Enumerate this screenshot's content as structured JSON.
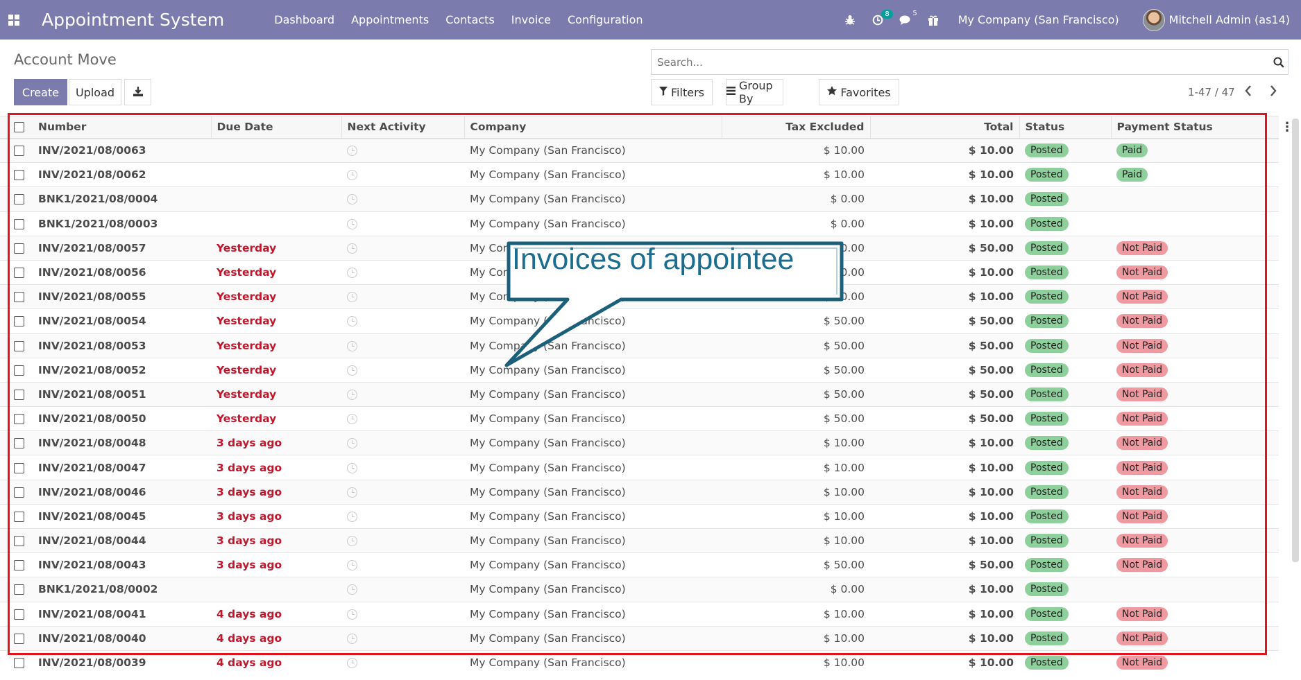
{
  "navbar": {
    "app_title": "Appointment System",
    "menu": [
      "Dashboard",
      "Appointments",
      "Contacts",
      "Invoice",
      "Configuration"
    ],
    "activity_count": "8",
    "messages_count": "5",
    "company": "My Company (San Francisco)",
    "user": "Mitchell Admin (as14)",
    "icons": [
      "apps-grid-icon",
      "bug-icon",
      "activity-clock-icon",
      "chat-icon",
      "gift-icon"
    ]
  },
  "control_panel": {
    "title": "Account Move",
    "search_placeholder": "Search...",
    "create_label": "Create",
    "upload_label": "Upload",
    "filters_label": "Filters",
    "groupby_label": "Group By",
    "favorites_label": "Favorites",
    "pager": "1-47 / 47"
  },
  "table": {
    "columns": [
      "Number",
      "Due Date",
      "Next Activity",
      "Company",
      "Tax Excluded",
      "Total",
      "Status",
      "Payment Status"
    ],
    "rows": [
      {
        "number": "INV/2021/08/0063",
        "due": "",
        "company": "My Company (San Francisco)",
        "tax_excluded": "$ 10.00",
        "total": "$ 10.00",
        "status": "Posted",
        "payment": "Paid"
      },
      {
        "number": "INV/2021/08/0062",
        "due": "",
        "company": "My Company (San Francisco)",
        "tax_excluded": "$ 10.00",
        "total": "$ 10.00",
        "status": "Posted",
        "payment": "Paid"
      },
      {
        "number": "BNK1/2021/08/0004",
        "due": "",
        "company": "My Company (San Francisco)",
        "tax_excluded": "$ 0.00",
        "total": "$ 10.00",
        "status": "Posted",
        "payment": ""
      },
      {
        "number": "BNK1/2021/08/0003",
        "due": "",
        "company": "My Company (San Francisco)",
        "tax_excluded": "$ 0.00",
        "total": "$ 10.00",
        "status": "Posted",
        "payment": ""
      },
      {
        "number": "INV/2021/08/0057",
        "due": "Yesterday",
        "company": "My Company (San Francisco)",
        "tax_excluded": "$ 50.00",
        "total": "$ 50.00",
        "status": "Posted",
        "payment": "Not Paid"
      },
      {
        "number": "INV/2021/08/0056",
        "due": "Yesterday",
        "company": "My Company (San Francisco)",
        "tax_excluded": "$ 10.00",
        "total": "$ 10.00",
        "status": "Posted",
        "payment": "Not Paid"
      },
      {
        "number": "INV/2021/08/0055",
        "due": "Yesterday",
        "company": "My Company (San Francisco)",
        "tax_excluded": "$ 10.00",
        "total": "$ 10.00",
        "status": "Posted",
        "payment": "Not Paid"
      },
      {
        "number": "INV/2021/08/0054",
        "due": "Yesterday",
        "company": "My Company (San Francisco)",
        "tax_excluded": "$ 50.00",
        "total": "$ 50.00",
        "status": "Posted",
        "payment": "Not Paid"
      },
      {
        "number": "INV/2021/08/0053",
        "due": "Yesterday",
        "company": "My Company (San Francisco)",
        "tax_excluded": "$ 50.00",
        "total": "$ 50.00",
        "status": "Posted",
        "payment": "Not Paid"
      },
      {
        "number": "INV/2021/08/0052",
        "due": "Yesterday",
        "company": "My Company (San Francisco)",
        "tax_excluded": "$ 50.00",
        "total": "$ 50.00",
        "status": "Posted",
        "payment": "Not Paid"
      },
      {
        "number": "INV/2021/08/0051",
        "due": "Yesterday",
        "company": "My Company (San Francisco)",
        "tax_excluded": "$ 50.00",
        "total": "$ 50.00",
        "status": "Posted",
        "payment": "Not Paid"
      },
      {
        "number": "INV/2021/08/0050",
        "due": "Yesterday",
        "company": "My Company (San Francisco)",
        "tax_excluded": "$ 50.00",
        "total": "$ 50.00",
        "status": "Posted",
        "payment": "Not Paid"
      },
      {
        "number": "INV/2021/08/0048",
        "due": "3 days ago",
        "company": "My Company (San Francisco)",
        "tax_excluded": "$ 10.00",
        "total": "$ 10.00",
        "status": "Posted",
        "payment": "Not Paid"
      },
      {
        "number": "INV/2021/08/0047",
        "due": "3 days ago",
        "company": "My Company (San Francisco)",
        "tax_excluded": "$ 10.00",
        "total": "$ 10.00",
        "status": "Posted",
        "payment": "Not Paid"
      },
      {
        "number": "INV/2021/08/0046",
        "due": "3 days ago",
        "company": "My Company (San Francisco)",
        "tax_excluded": "$ 10.00",
        "total": "$ 10.00",
        "status": "Posted",
        "payment": "Not Paid"
      },
      {
        "number": "INV/2021/08/0045",
        "due": "3 days ago",
        "company": "My Company (San Francisco)",
        "tax_excluded": "$ 10.00",
        "total": "$ 10.00",
        "status": "Posted",
        "payment": "Not Paid"
      },
      {
        "number": "INV/2021/08/0044",
        "due": "3 days ago",
        "company": "My Company (San Francisco)",
        "tax_excluded": "$ 10.00",
        "total": "$ 10.00",
        "status": "Posted",
        "payment": "Not Paid"
      },
      {
        "number": "INV/2021/08/0043",
        "due": "3 days ago",
        "company": "My Company (San Francisco)",
        "tax_excluded": "$ 50.00",
        "total": "$ 50.00",
        "status": "Posted",
        "payment": "Not Paid"
      },
      {
        "number": "BNK1/2021/08/0002",
        "due": "",
        "company": "My Company (San Francisco)",
        "tax_excluded": "$ 0.00",
        "total": "$ 10.00",
        "status": "Posted",
        "payment": ""
      },
      {
        "number": "INV/2021/08/0041",
        "due": "4 days ago",
        "company": "My Company (San Francisco)",
        "tax_excluded": "$ 10.00",
        "total": "$ 10.00",
        "status": "Posted",
        "payment": "Not Paid"
      },
      {
        "number": "INV/2021/08/0040",
        "due": "4 days ago",
        "company": "My Company (San Francisco)",
        "tax_excluded": "$ 10.00",
        "total": "$ 10.00",
        "status": "Posted",
        "payment": "Not Paid"
      },
      {
        "number": "INV/2021/08/0039",
        "due": "4 days ago",
        "company": "My Company (San Francisco)",
        "tax_excluded": "$ 10.00",
        "total": "$ 10.00",
        "status": "Posted",
        "payment": "Not Paid"
      }
    ]
  },
  "annotation": {
    "callout_text": "Invoices of appointee",
    "highlight_color": "#e0131e",
    "callout_border_color": "#1b5f7a"
  },
  "colors": {
    "navbar": "#7c7bad",
    "overdue_text": "#c0172c",
    "status_green": "#8ed09c",
    "status_red": "#ee9aa0"
  }
}
